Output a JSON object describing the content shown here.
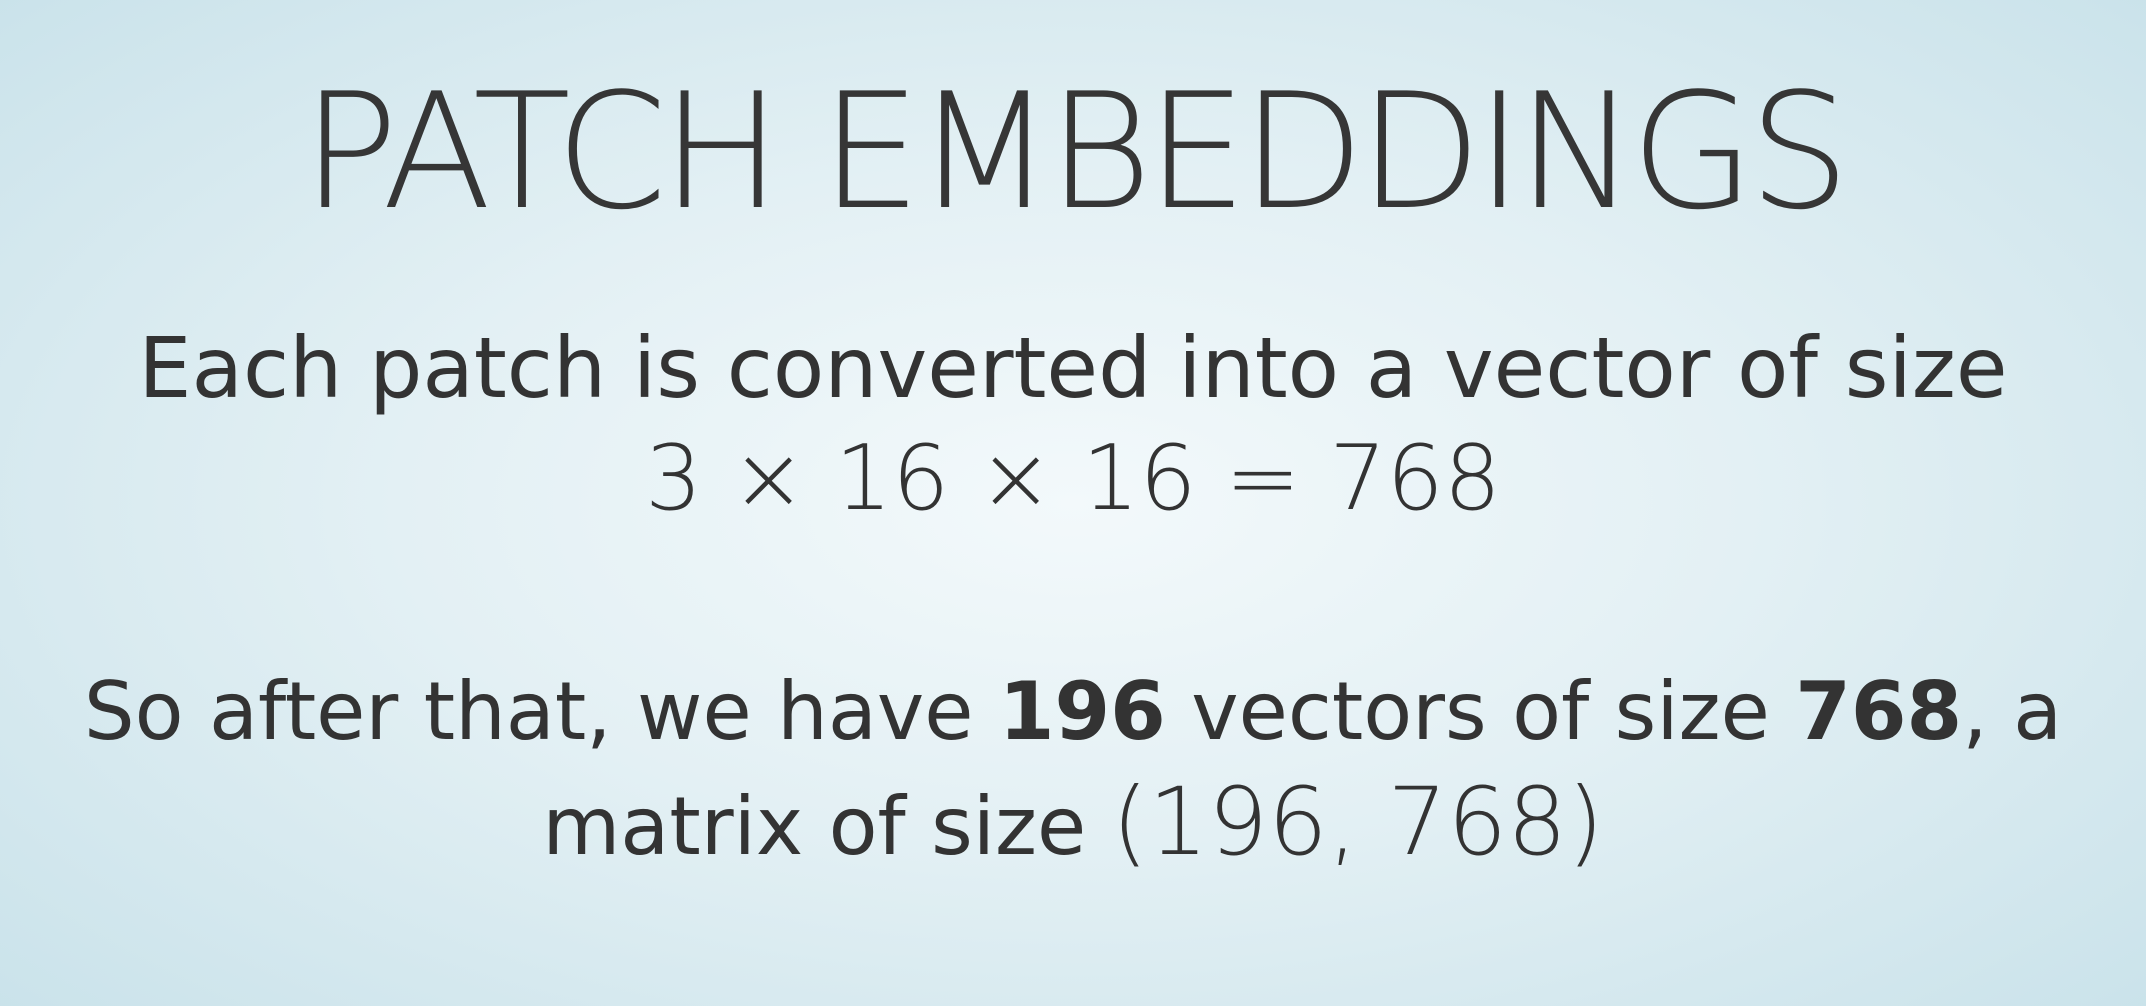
{
  "title": "PATCH EMBEDDINGS",
  "line1": "Each patch is converted into a vector of size",
  "equation": "3 × 16 × 16  =  768",
  "summary": {
    "part1": "So after that, we have ",
    "count": "196",
    "part2": " vectors of size ",
    "size": "768",
    "part3": ", a",
    "part4": "matrix of size ",
    "matrix": "(196, 768)"
  }
}
